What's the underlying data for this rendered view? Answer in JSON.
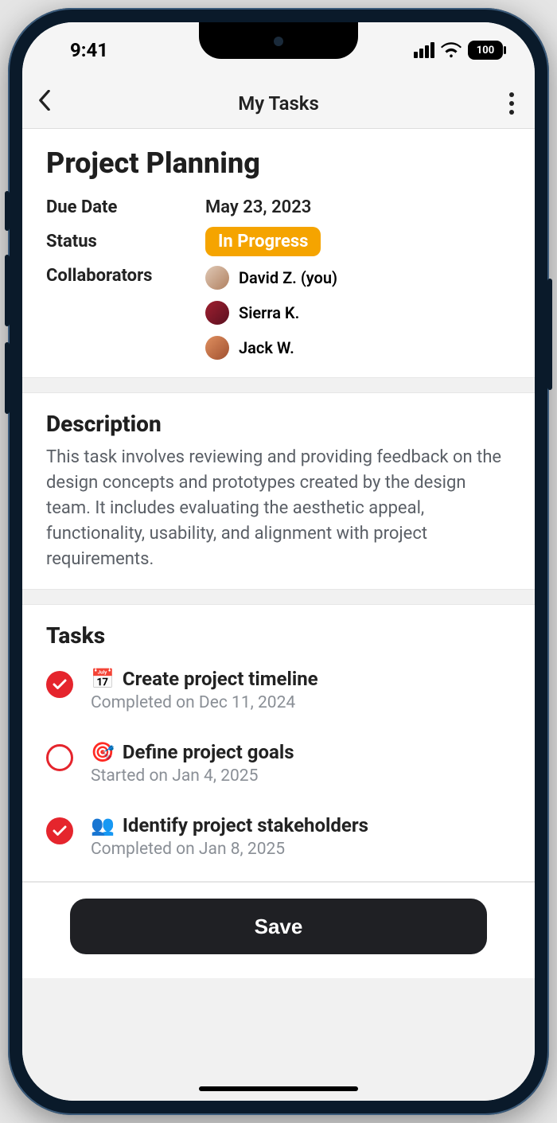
{
  "statusbar": {
    "time": "9:41",
    "battery": "100"
  },
  "header": {
    "title": "My Tasks"
  },
  "task": {
    "title": "Project Planning",
    "due_label": "Due Date",
    "due_value": "May 23, 2023",
    "status_label": "Status",
    "status_value": "In Progress",
    "status_color": "#f5a400",
    "collab_label": "Collaborators",
    "collaborators": [
      {
        "name": "David Z. (you)"
      },
      {
        "name": "Sierra K."
      },
      {
        "name": "Jack W."
      }
    ]
  },
  "description": {
    "heading": "Description",
    "body": "This task involves reviewing and providing feedback on the design concepts and prototypes created by the design team. It includes evaluating the aesthetic appeal, functionality, usability, and alignment with project requirements."
  },
  "subtasks": {
    "heading": "Tasks",
    "items": [
      {
        "done": true,
        "emoji": "📅",
        "title": "Create project timeline",
        "sub": "Completed on Dec 11, 2024"
      },
      {
        "done": false,
        "emoji": "🎯",
        "title": "Define project goals",
        "sub": "Started on Jan 4, 2025"
      },
      {
        "done": true,
        "emoji": "👥",
        "title": "Identify project stakeholders",
        "sub": "Completed on Jan 8, 2025"
      }
    ]
  },
  "footer": {
    "save_label": "Save"
  }
}
